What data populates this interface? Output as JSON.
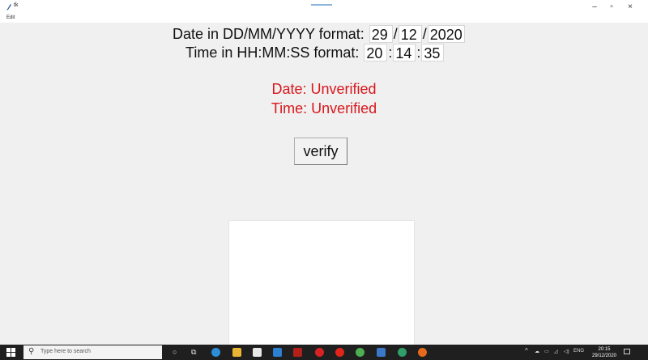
{
  "window": {
    "title": "tk",
    "menu_edit": "Edit",
    "controls": {
      "minimize": "–",
      "maximize": "▫",
      "close": "×"
    }
  },
  "form": {
    "date_label": "Date in DD/MM/YYYY format:",
    "date": {
      "day": "29",
      "month": "12",
      "year": "2020",
      "separator": "/"
    },
    "time_label": "Time in HH:MM:SS format:",
    "time": {
      "hour": "20",
      "minute": "14",
      "second": "35",
      "separator": ":"
    }
  },
  "status": {
    "date": "Date: Unverified",
    "time": "Time: Unverified",
    "color": "#d9171c"
  },
  "verify_button": "verify",
  "taskbar": {
    "search_placeholder": "Type here to search",
    "apps": [
      "cortana-icon",
      "task-view-icon",
      "edge-icon",
      "file-explorer-icon",
      "store-icon",
      "mail-icon",
      "app-red-icon",
      "app-record-icon",
      "opera-icon",
      "chrome-icon",
      "python-icon",
      "app-circle-icon",
      "firefox-icon"
    ],
    "tray": {
      "language": "ENG",
      "chevron": "^"
    },
    "clock": {
      "time": "20:15",
      "date": "29/12/2020"
    }
  }
}
